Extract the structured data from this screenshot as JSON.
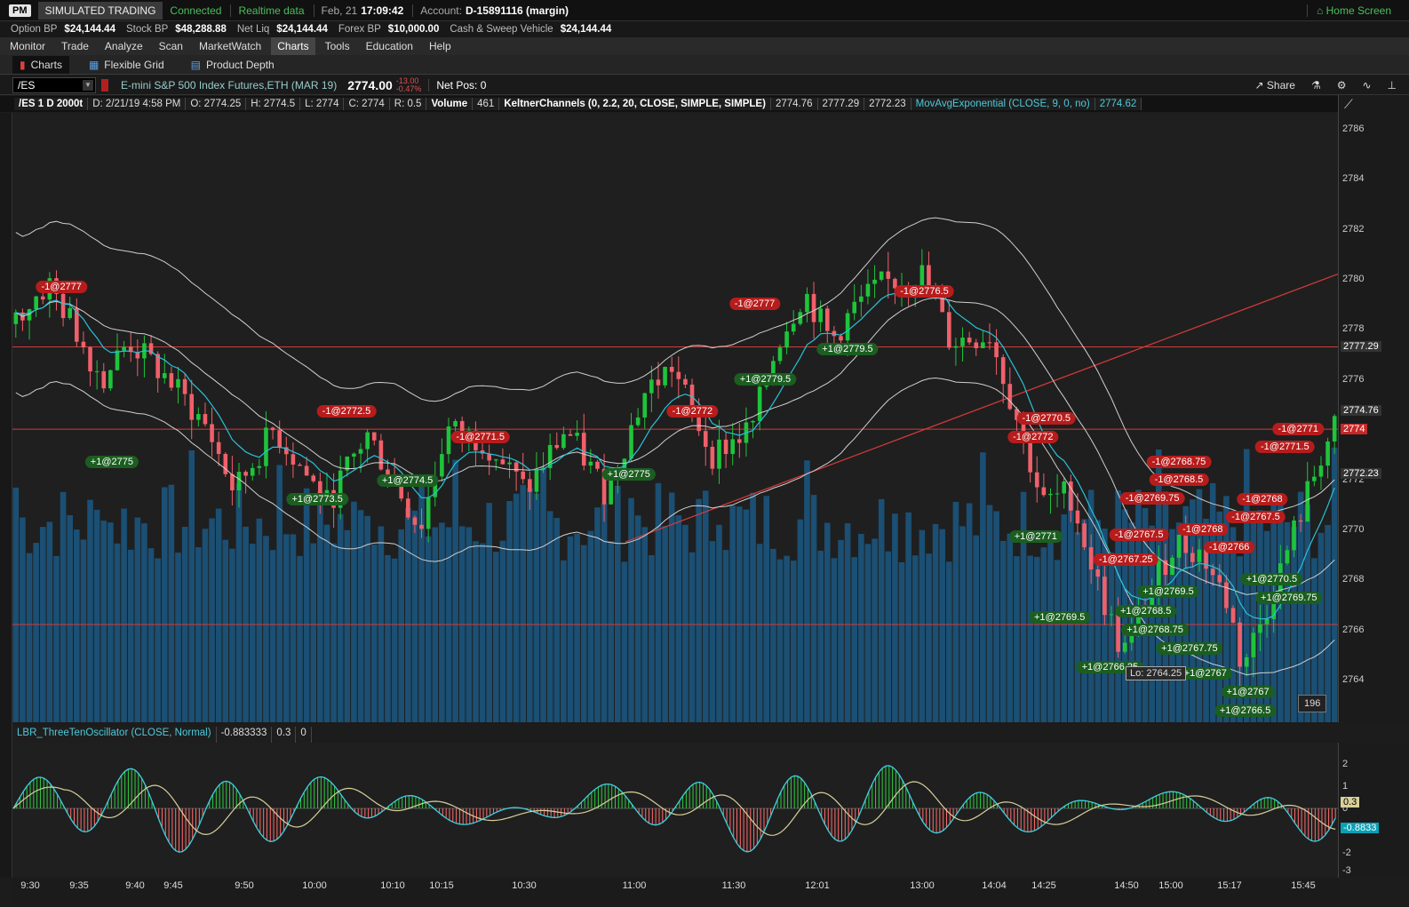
{
  "topbar": {
    "pm_badge": "PM",
    "mode": "SIMULATED TRADING",
    "connection": "Connected",
    "data_feed": "Realtime data",
    "date": "Feb, 21",
    "time": "17:09:42",
    "account_label": "Account:",
    "account_value": "D-15891116 (margin)",
    "home_label": "Home Screen"
  },
  "balances": [
    {
      "label": "Option BP",
      "value": "$24,144.44"
    },
    {
      "label": "Stock BP",
      "value": "$48,288.88"
    },
    {
      "label": "Net Liq",
      "value": "$24,144.44"
    },
    {
      "label": "Forex BP",
      "value": "$10,000.00"
    },
    {
      "label": "Cash & Sweep Vehicle",
      "value": "$24,144.44"
    }
  ],
  "menu": [
    "Monitor",
    "Trade",
    "Analyze",
    "Scan",
    "MarketWatch",
    "Charts",
    "Tools",
    "Education",
    "Help"
  ],
  "menu_active": "Charts",
  "subtabs": [
    "Charts",
    "Flexible Grid",
    "Product Depth"
  ],
  "symbol_bar": {
    "symbol": "/ES",
    "description": "E-mini S&P 500 Index Futures,ETH (MAR 19)",
    "last_price": "2774.00",
    "change": "-13.00",
    "change_pct": "-0.47%",
    "net_pos": "Net Pos: 0",
    "share_label": "Share"
  },
  "study_bar": {
    "title": "/ES 1 D 2000t",
    "date": "D: 2/21/19 4:58 PM",
    "open": "O: 2774.25",
    "high": "H: 2774.5",
    "low": "L: 2774",
    "close": "C: 2774",
    "range": "R: 0.5",
    "volume_label": "Volume",
    "volume_value": "461",
    "keltner_label": "KeltnerChannels (0, 2.2, 20, CLOSE, SIMPLE, SIMPLE)",
    "keltner_v1": "2774.76",
    "keltner_v2": "2777.29",
    "keltner_v3": "2772.23",
    "ema_label": "MovAvgExponential (CLOSE, 9, 0, no)",
    "ema_value": "2774.62"
  },
  "price_axis": {
    "ticks": [
      "2786",
      "2784",
      "2782",
      "2780",
      "2778",
      "2776",
      "2774",
      "2772",
      "2770",
      "2768",
      "2766",
      "2764"
    ],
    "labels": [
      {
        "text": "2777.29",
        "price": 2777.29,
        "color": "#ffffff",
        "bg": "#333333"
      },
      {
        "text": "2774.76",
        "price": 2774.76,
        "color": "#ffffff",
        "bg": "#333333"
      },
      {
        "text": "2774",
        "price": 2774.0,
        "color": "#ffffff",
        "bg": "#c62828"
      },
      {
        "text": "2772.23",
        "price": 2772.23,
        "color": "#ffffff",
        "bg": "#333333"
      }
    ]
  },
  "time_axis": [
    "9:30",
    "9:35",
    "9:40",
    "9:45",
    "9:50",
    "10:00",
    "10:10",
    "10:15",
    "10:30",
    "11:00",
    "11:30",
    "12:01",
    "13:00",
    "14:04",
    "14:25",
    "14:50",
    "15:00",
    "15:17",
    "15:45"
  ],
  "trade_tags": [
    {
      "text": "-1@2777",
      "side": "sell",
      "x": 0.037,
      "p": 2779.7
    },
    {
      "text": "-1@2777",
      "side": "sell",
      "x": 0.56,
      "p": 2779.0
    },
    {
      "text": "-1@2776.5",
      "side": "sell",
      "x": 0.688,
      "p": 2779.5
    },
    {
      "text": "-1@2772.5",
      "side": "sell",
      "x": 0.252,
      "p": 2774.7
    },
    {
      "text": "-1@2772",
      "side": "sell",
      "x": 0.513,
      "p": 2774.7
    },
    {
      "text": "-1@2771.5",
      "side": "sell",
      "x": 0.353,
      "p": 2773.7
    },
    {
      "text": "-1@2770.5",
      "side": "sell",
      "x": 0.78,
      "p": 2774.45
    },
    {
      "text": "-1@2772",
      "side": "sell",
      "x": 0.77,
      "p": 2773.7
    },
    {
      "text": "-1@2768.75",
      "side": "sell",
      "x": 0.88,
      "p": 2772.7
    },
    {
      "text": "-1@2768.5",
      "side": "sell",
      "x": 0.88,
      "p": 2772.0
    },
    {
      "text": "-1@2769.75",
      "side": "sell",
      "x": 0.86,
      "p": 2771.25
    },
    {
      "text": "-1@2767.5",
      "side": "sell",
      "x": 0.85,
      "p": 2769.8
    },
    {
      "text": "-1@2767.25",
      "side": "sell",
      "x": 0.84,
      "p": 2768.8
    },
    {
      "text": "-1@2768",
      "side": "sell",
      "x": 0.898,
      "p": 2770.0
    },
    {
      "text": "-1@2766",
      "side": "sell",
      "x": 0.918,
      "p": 2769.3
    },
    {
      "text": "-1@2767.5",
      "side": "sell",
      "x": 0.938,
      "p": 2770.5
    },
    {
      "text": "-1@2768",
      "side": "sell",
      "x": 0.943,
      "p": 2771.2
    },
    {
      "text": "-1@2771",
      "side": "sell",
      "x": 0.97,
      "p": 2774.0
    },
    {
      "text": "-1@2771.5",
      "side": "sell",
      "x": 0.96,
      "p": 2773.3
    },
    {
      "text": "+1@2775",
      "side": "buy",
      "x": 0.075,
      "p": 2772.7
    },
    {
      "text": "+1@2773.5",
      "side": "buy",
      "x": 0.23,
      "p": 2771.2
    },
    {
      "text": "+1@2774.5",
      "side": "buy",
      "x": 0.298,
      "p": 2771.95
    },
    {
      "text": "+1@2775",
      "side": "buy",
      "x": 0.465,
      "p": 2772.2
    },
    {
      "text": "+1@2779.5",
      "side": "buy",
      "x": 0.568,
      "p": 2776.0
    },
    {
      "text": "+1@2779.5",
      "side": "buy",
      "x": 0.63,
      "p": 2777.2
    },
    {
      "text": "+1@2771",
      "side": "buy",
      "x": 0.772,
      "p": 2769.7
    },
    {
      "text": "+1@2769.5",
      "side": "buy",
      "x": 0.79,
      "p": 2766.5
    },
    {
      "text": "+1@2769.5",
      "side": "buy",
      "x": 0.872,
      "p": 2767.5
    },
    {
      "text": "+1@2768.5",
      "side": "buy",
      "x": 0.855,
      "p": 2766.75
    },
    {
      "text": "+1@2768.75",
      "side": "buy",
      "x": 0.862,
      "p": 2766.0
    },
    {
      "text": "+1@2766.25",
      "side": "buy",
      "x": 0.828,
      "p": 2764.5
    },
    {
      "text": "+1@2767.75",
      "side": "buy",
      "x": 0.888,
      "p": 2765.25
    },
    {
      "text": "+1@2767",
      "side": "buy",
      "x": 0.9,
      "p": 2764.25
    },
    {
      "text": "+1@2767",
      "side": "buy",
      "x": 0.932,
      "p": 2763.5
    },
    {
      "text": "+1@2766.5",
      "side": "buy",
      "x": 0.93,
      "p": 2762.75
    },
    {
      "text": "+1@2770.5",
      "side": "buy",
      "x": 0.95,
      "p": 2768.0
    },
    {
      "text": "+1@2769.75",
      "side": "buy",
      "x": 0.963,
      "p": 2767.25
    }
  ],
  "low_label": "Lo: 2764.25",
  "bar_count": "196",
  "oscillator": {
    "label": "LBR_ThreeTenOscillator (CLOSE, Normal)",
    "value1": "-0.883333",
    "value2": "0.3",
    "value3": "0",
    "ticks": [
      "2",
      "1",
      "0",
      "-1",
      "-2",
      "-3"
    ],
    "label_fast": "0.3",
    "label_slow": "-0.8833"
  },
  "colors": {
    "up_candle": "#1ec43a",
    "down_candle": "#f0606a",
    "volume": "#1b4f73",
    "keltner": "#d0d0d0",
    "ema": "#27c3d8",
    "hline": "#d23a3a",
    "osc_pos": "#2ecc40",
    "osc_neg": "#ff6b6b",
    "osc_fast": "#3fd0e0",
    "osc_slow": "#d8cf9a"
  }
}
